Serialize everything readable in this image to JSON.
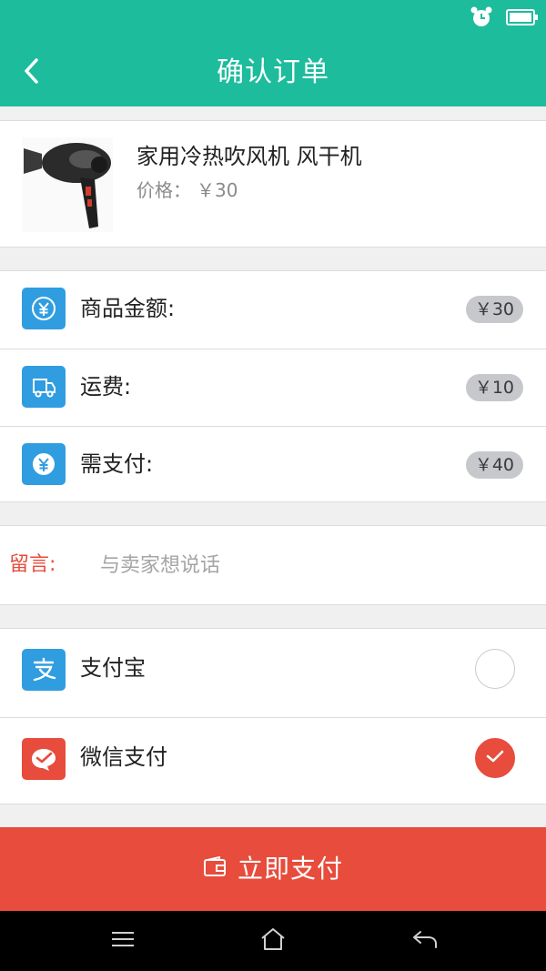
{
  "header": {
    "title": "确认订单",
    "bg_color": "#1dbc9c",
    "back_icon": "chevron-left-icon"
  },
  "status_bar": {
    "icons": [
      "alarm-icon",
      "battery-icon"
    ]
  },
  "product": {
    "name": "家用冷热吹风机 风干机",
    "price_label": "价格：",
    "price": "￥30",
    "image": "hair-dryer-image"
  },
  "amounts": [
    {
      "label": "商品金额:",
      "value": "￥30",
      "icon": "yuan-circle-icon"
    },
    {
      "label": "运费:",
      "value": "￥10",
      "icon": "truck-icon"
    },
    {
      "label": "需支付:",
      "value": "￥40",
      "icon": "yuan-drop-icon"
    }
  ],
  "message": {
    "label": "留言:",
    "placeholder": "与卖家想说话",
    "value": ""
  },
  "payment": {
    "options": [
      {
        "label": "支付宝",
        "icon": "alipay-icon",
        "color": "#2f9de0",
        "selected": false
      },
      {
        "label": "微信支付",
        "icon": "wechat-pay-icon",
        "color": "#e74c3c",
        "selected": true
      }
    ]
  },
  "pay_button": {
    "label": "立即支付",
    "icon": "wallet-icon",
    "color": "#e74c3c"
  },
  "nav": {
    "buttons": [
      "menu-icon",
      "home-icon",
      "back-arrow-icon"
    ]
  }
}
